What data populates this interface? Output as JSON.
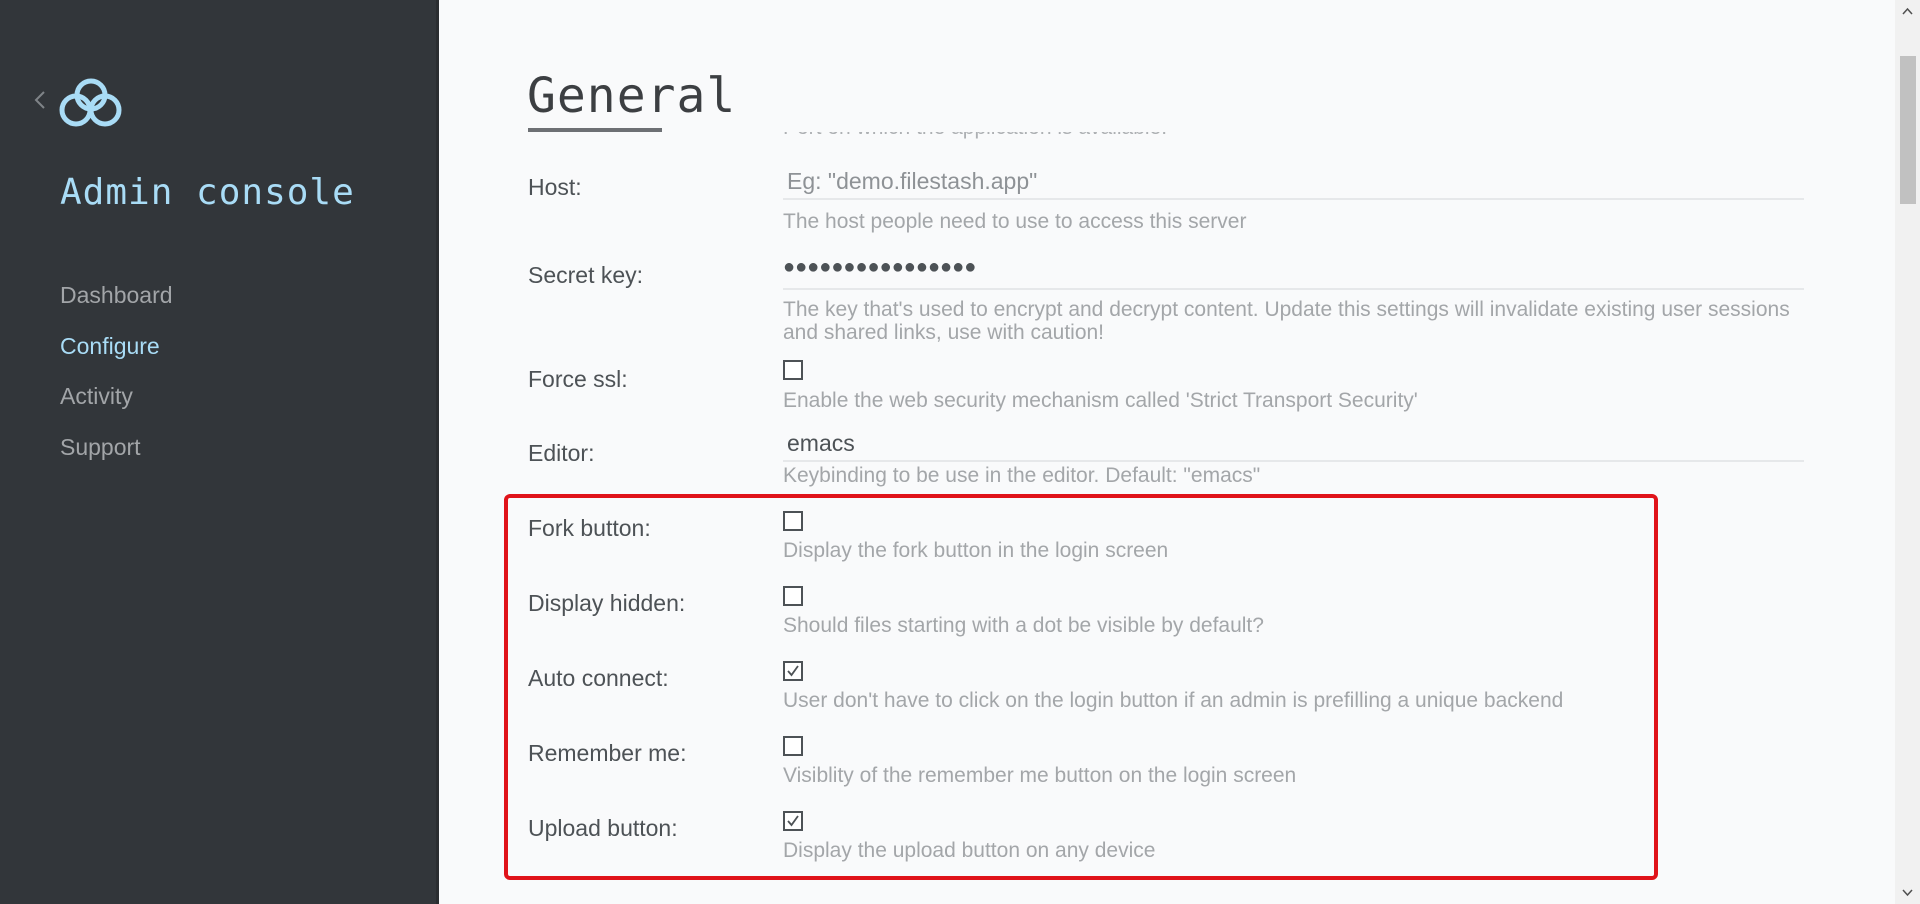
{
  "sidebar": {
    "app_title": "Admin console",
    "items": [
      {
        "label": "Dashboard",
        "active": false
      },
      {
        "label": "Configure",
        "active": true
      },
      {
        "label": "Activity",
        "active": false
      },
      {
        "label": "Support",
        "active": false
      }
    ]
  },
  "main": {
    "title": "General",
    "cut_off_description": "Port on which the application is available.",
    "fields": {
      "host": {
        "label": "Host:",
        "placeholder": "Eg: \"demo.filestash.app\"",
        "value": "",
        "description": "The host people need to use to access this server"
      },
      "secret_key": {
        "label": "Secret key:",
        "masked_value": "●●●●●●●●●●●●●●●●",
        "description": "The key that's used to encrypt and decrypt content. Update this settings will invalidate existing user sessions and shared links, use with caution!"
      },
      "force_ssl": {
        "label": "Force ssl:",
        "checked": false,
        "description": "Enable the web security mechanism called 'Strict Transport Security'"
      },
      "editor": {
        "label": "Editor:",
        "value": "emacs",
        "description": "Keybinding to be use in the editor. Default: \"emacs\""
      },
      "fork_button": {
        "label": "Fork button:",
        "checked": false,
        "description": "Display the fork button in the login screen"
      },
      "display_hidden": {
        "label": "Display hidden:",
        "checked": false,
        "description": "Should files starting with a dot be visible by default?"
      },
      "auto_connect": {
        "label": "Auto connect:",
        "checked": true,
        "description": "User don't have to click on the login button if an admin is prefilling a unique backend"
      },
      "remember_me": {
        "label": "Remember me:",
        "checked": false,
        "description": "Visiblity of the remember me button on the login screen"
      },
      "upload_button": {
        "label": "Upload button:",
        "checked": true,
        "description": "Display the upload button on any device"
      }
    }
  },
  "colors": {
    "sidebar_bg": "#32363a",
    "accent": "#a9dcf6",
    "highlight": "#e0131a"
  }
}
